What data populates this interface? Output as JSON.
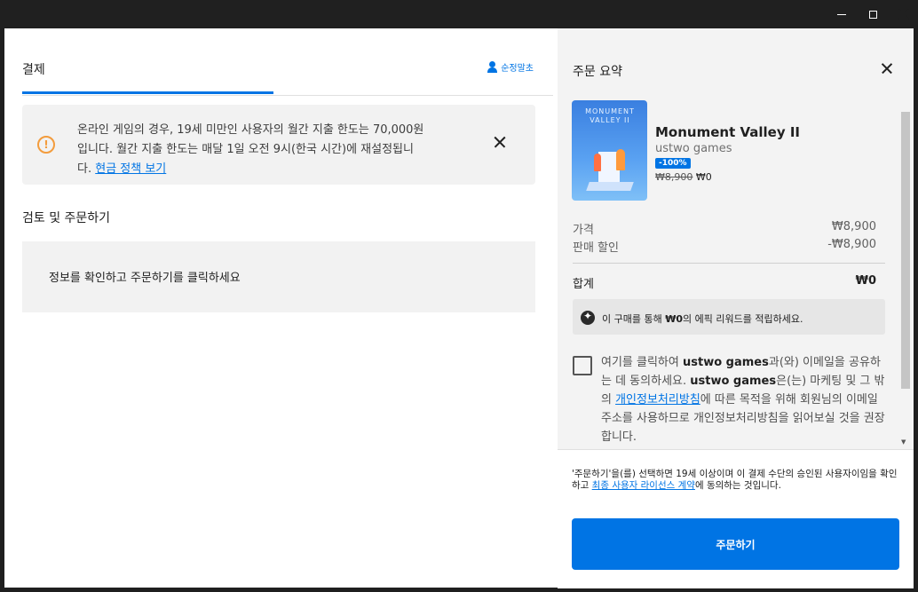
{
  "left": {
    "tab_label": "결제",
    "signout": "순정말초",
    "notice": {
      "line1": "온라인 게임의 경우, 19세 미만인 사용자의 월간 지출 한도는 70,000원",
      "line2": "입니다. 월간 지출 한도는 매달 1일 오전 9시(한국 시간)에 재설정됩니",
      "line3_pre": "다.",
      "link": "현금 정책 보기"
    },
    "review_title": "검토 및 주문하기",
    "review_text": "정보를 확인하고 주문하기를 클릭하세요"
  },
  "summary": {
    "title": "주문 요약",
    "cover_logo": "MONUMENT VALLEY II",
    "game_title": "Monument Valley II",
    "publisher": "ustwo games",
    "discount_badge": "-100%",
    "original_price": "₩8,900",
    "final_price": "₩0",
    "price_label": "가격",
    "price_value": "₩8,900",
    "discount_label": "판매 할인",
    "discount_value": "-₩8,900",
    "total_label": "합계",
    "total_value": "₩0",
    "reward_pre": "이 구매를 통해 ",
    "reward_amount": "₩0",
    "reward_post": "의 에픽 리워드를 적립하세요.",
    "consent": {
      "p1": "여기를 클릭하여 ",
      "b1": "ustwo games",
      "p2": "과(와) 이메일을 공유하는 데 동의하세요. ",
      "b2": "ustwo games",
      "p3": "은(는) 마케팅 및 그 밖의 ",
      "link": "개인정보처리방침",
      "p4": "에 따른 목적을 위해 회원님의 이메일 주소를 사용하므로 개인정보처리방침을 읽어보실 것을 권장합니다."
    },
    "footer": {
      "p1": "'주문하기'을(를) 선택하면 19세 이상이며 이 결제 수단의 승인된 사용자이임을 확인하고 ",
      "link": "최종 사용자 라이선스 계약",
      "p2": "에 동의하는 것입니다."
    },
    "order_button": "주문하기"
  }
}
